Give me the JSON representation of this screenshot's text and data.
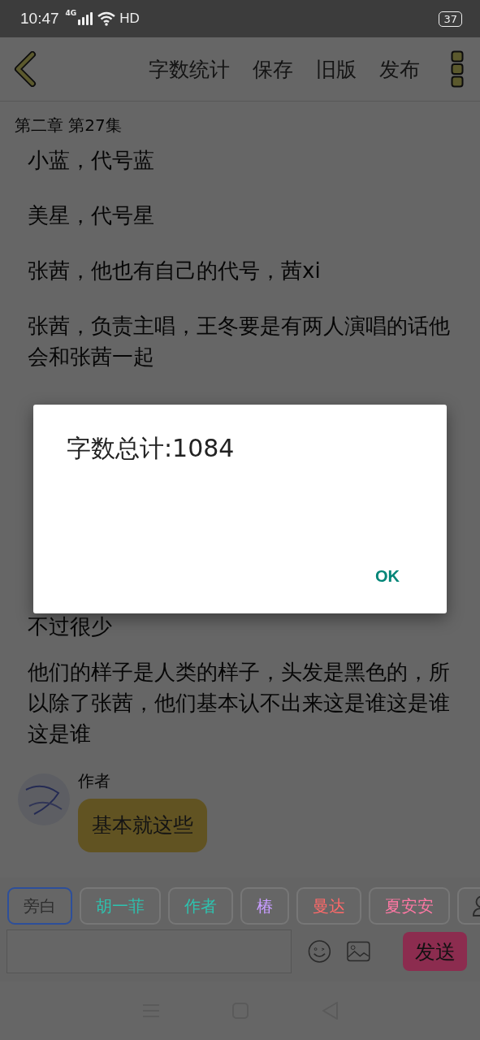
{
  "status_bar": {
    "time": "10:47",
    "network": "4G",
    "hd": "HD",
    "battery": "37"
  },
  "toolbar": {
    "actions": [
      "字数统计",
      "保存",
      "旧版",
      "发布"
    ]
  },
  "chapter_title": "第二章 第27集",
  "paragraphs_above": [
    "小蓝，代号蓝",
    "美星，代号星",
    "张茜，他也有自己的代号，茜xi",
    "张茜，负责主唱，王冬要是有两人演唱的话他会和张茜一起"
  ],
  "paragraphs_below": [
    "不过很少",
    "他们的样子是人类的样子，头发是黑色的，所以除了张茜，他们基本认不出来这是谁这是谁这是谁"
  ],
  "chat": {
    "author": "作者",
    "message": "基本就这些"
  },
  "speakers": [
    {
      "label": "旁白",
      "color": "#2e2e2e",
      "selected": true
    },
    {
      "label": "胡一菲",
      "color": "#2dc4b0",
      "selected": false
    },
    {
      "label": "作者",
      "color": "#2dc4b0",
      "selected": false
    },
    {
      "label": "椿",
      "color": "#c79cff",
      "selected": false
    },
    {
      "label": "曼达",
      "color": "#ff6a6a",
      "selected": false
    },
    {
      "label": "夏安安",
      "color": "#ff78a4",
      "selected": false
    }
  ],
  "composer": {
    "send": "发送"
  },
  "dialog": {
    "title": "字数总计:1084",
    "button": "OK"
  }
}
